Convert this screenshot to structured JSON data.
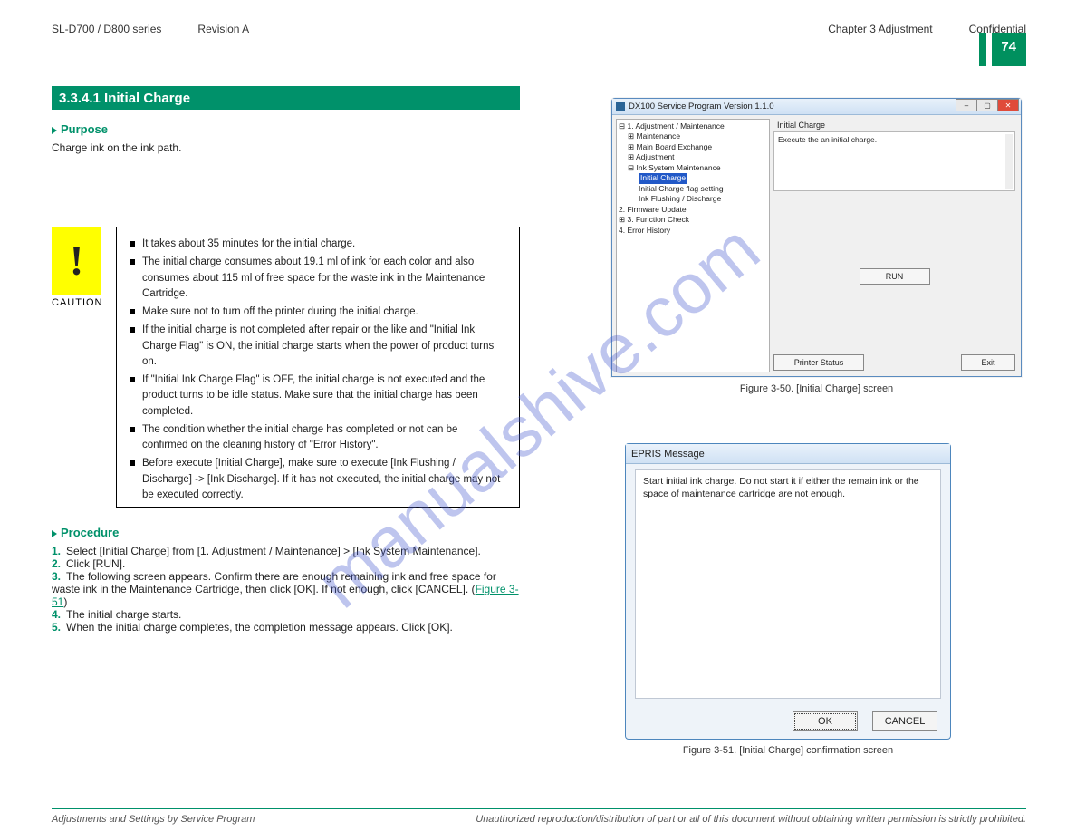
{
  "header": {
    "top_left_1": "SL-D700 / D800 series",
    "top_left_2": "Revision A",
    "top_right_1": "Chapter 3  Adjustment",
    "top_right_2": "Confidential"
  },
  "page_number": "74",
  "section_title": "3.3.4.1  Initial Charge",
  "purpose": {
    "heading": "Purpose",
    "text": "Charge ink on the ink path."
  },
  "caution": {
    "icon_char": "!",
    "label": "CAUTION",
    "bullets": [
      "It takes about 35 minutes for the initial charge.",
      "The initial charge consumes about 19.1 ml of ink for each color and also consumes about 115 ml of free space for the waste ink in the Maintenance Cartridge.",
      "Make sure not to turn off the printer during the initial charge.",
      "If the initial charge is not completed after repair or the like and \"Initial Ink Charge Flag\" is ON, the initial charge starts when the power of product turns on.",
      "If \"Initial Ink Charge Flag\" is OFF, the initial charge is not executed and the product turns to be idle status. Make sure that the initial charge has been completed.",
      "The condition whether the initial charge has completed or not can be confirmed on the cleaning history of \"Error History\".",
      "Before execute [Initial Charge], make sure to execute [Ink Flushing / Discharge] -> [Ink Discharge]. If it has not executed, the initial charge may not be executed correctly."
    ]
  },
  "procedure": {
    "heading": "Procedure",
    "steps": [
      {
        "n": "1.",
        "text": "Select [Initial Charge] from [1. Adjustment / Maintenance] > [Ink System Maintenance]."
      },
      {
        "n": "2.",
        "text": "Click [RUN]."
      },
      {
        "n": "3.",
        "text": "The following screen appears. Confirm there are enough remaining ink and free space for waste ink in the Maintenance Cartridge, then click [OK]. If not enough, click [CANCEL].",
        "ref": "Figure 3-51"
      },
      {
        "n": "4.",
        "text": "The initial charge starts."
      },
      {
        "n": "5.",
        "text": "When the initial charge completes, the completion message appears. Click [OK]."
      }
    ]
  },
  "figure1": {
    "caption": "Figure 3-50. [Initial Charge] screen",
    "window_title": "DX100 Service Program  Version 1.1.0",
    "tree": {
      "root": "1. Adjustment / Maintenance",
      "children": [
        "Maintenance",
        "Main Board Exchange",
        "Adjustment",
        "Ink System Maintenance"
      ],
      "ink_children": [
        "Initial Charge",
        "Initial Charge flag setting",
        "Ink Flushing / Discharge"
      ],
      "others": [
        "2. Firmware Update",
        "3. Function Check",
        "4. Error History"
      ]
    },
    "group_label": "Initial Charge",
    "description": "Execute the an initial charge.",
    "run_label": "RUN",
    "printer_status": "Printer Status",
    "exit": "Exit"
  },
  "figure2": {
    "caption": "Figure 3-51. [Initial Charge] confirmation screen",
    "title": "EPRIS Message",
    "body": "Start initial ink charge. Do not start it if either the remain ink or the space of maintenance cartridge are not enough.",
    "ok": "OK",
    "cancel": "CANCEL"
  },
  "footer": {
    "left": "Adjustments and Settings by Service Program",
    "right": "Unauthorized reproduction/distribution of part or all of this document without obtaining written permission is strictly prohibited."
  },
  "watermark": "manualshive.com"
}
